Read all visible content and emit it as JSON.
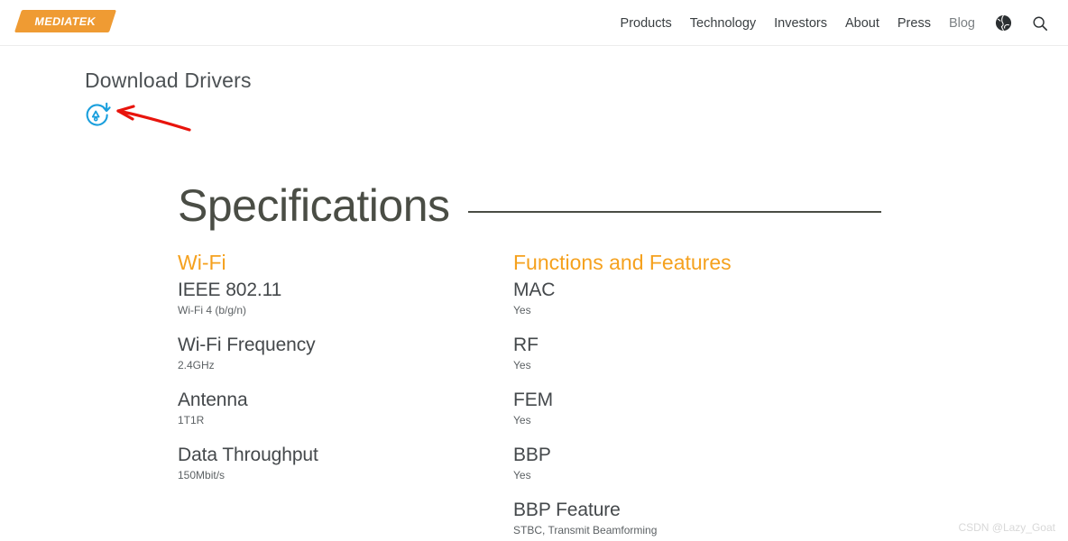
{
  "header": {
    "logo_text": "MEDIATEK",
    "logo_color": "#ef9b33",
    "nav_items": [
      {
        "label": "Products",
        "muted": false
      },
      {
        "label": "Technology",
        "muted": false
      },
      {
        "label": "Investors",
        "muted": false
      },
      {
        "label": "About",
        "muted": false
      },
      {
        "label": "Press",
        "muted": false
      },
      {
        "label": "Blog",
        "muted": true
      }
    ],
    "icons": [
      {
        "name": "globe-icon"
      },
      {
        "name": "search-icon"
      }
    ]
  },
  "download": {
    "title": "Download Drivers",
    "icon_name": "download-circular-arrow-icon",
    "icon_color": "#1a9fdd",
    "annotation_color": "#e8140c"
  },
  "specifications": {
    "heading": "Specifications",
    "rule_color": "#4a4d45",
    "accent_color": "#f5a11e",
    "columns": [
      {
        "heading": "Wi-Fi",
        "items": [
          {
            "label": "IEEE 802.11",
            "value": "Wi-Fi 4 (b/g/n)"
          },
          {
            "label": "Wi-Fi Frequency",
            "value": "2.4GHz"
          },
          {
            "label": "Antenna",
            "value": "1T1R"
          },
          {
            "label": "Data Throughput",
            "value": "150Mbit/s"
          }
        ]
      },
      {
        "heading": "Functions and Features",
        "items": [
          {
            "label": "MAC",
            "value": "Yes"
          },
          {
            "label": "RF",
            "value": "Yes"
          },
          {
            "label": "FEM",
            "value": "Yes"
          },
          {
            "label": "BBP",
            "value": "Yes"
          },
          {
            "label": "BBP Feature",
            "value": "STBC, Transmit Beamforming"
          }
        ]
      }
    ]
  },
  "watermark": {
    "text": "CSDN @Lazy_Goat"
  }
}
